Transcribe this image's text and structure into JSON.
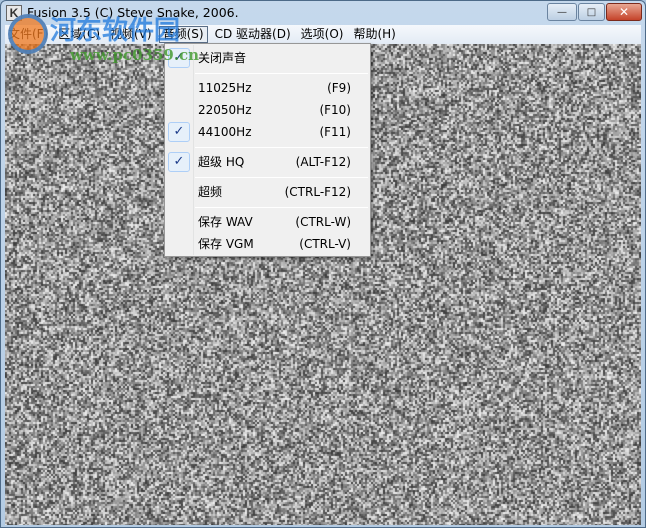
{
  "window": {
    "title": "Fusion 3.5 (C) Steve Snake, 2006.",
    "icon": "fusion-k-icon",
    "app_icon_letter": "K",
    "minimize": "—",
    "maximize": "□",
    "close": "✕"
  },
  "menubar": [
    {
      "label": "文件(F)"
    },
    {
      "label": "区域(C)"
    },
    {
      "label": "视频(V)"
    },
    {
      "label": "音频(S)",
      "active": true
    },
    {
      "label": "CD 驱动器(D)"
    },
    {
      "label": "选项(O)"
    },
    {
      "label": "帮助(H)"
    }
  ],
  "audio_menu": {
    "items": [
      {
        "label": "关闭声音",
        "shortcut": "",
        "checked": true
      },
      {
        "label": "11025Hz",
        "shortcut": "(F9)",
        "checked": false
      },
      {
        "label": "22050Hz",
        "shortcut": "(F10)",
        "checked": false
      },
      {
        "label": "44100Hz",
        "shortcut": "(F11)",
        "checked": true
      },
      {
        "label": "超级 HQ",
        "shortcut": "(ALT-F12)",
        "checked": true
      },
      {
        "label": "超频",
        "shortcut": "(CTRL-F12)",
        "checked": false
      },
      {
        "label": "保存 WAV",
        "shortcut": "(CTRL-W)",
        "checked": false
      },
      {
        "label": "保存 VGM",
        "shortcut": "(CTRL-V)",
        "checked": false
      }
    ],
    "check_glyph": "✓"
  },
  "watermark": {
    "name": "河东软件园",
    "url": "www.pc0359.cn"
  }
}
